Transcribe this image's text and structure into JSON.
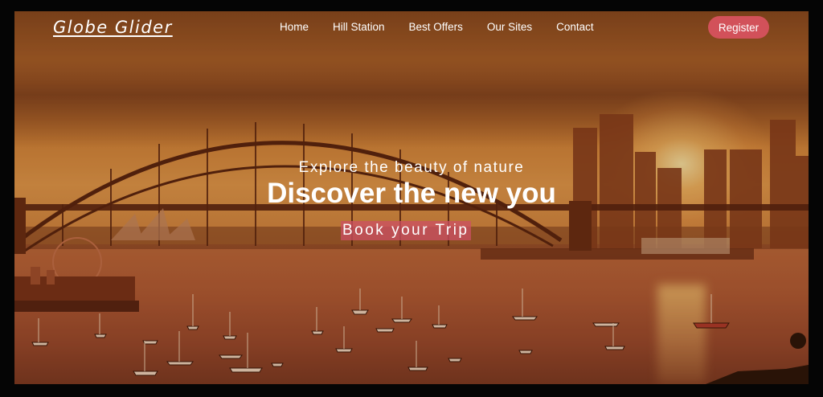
{
  "brand": {
    "name": "Globe Glider"
  },
  "nav": {
    "items": [
      {
        "label": "Home"
      },
      {
        "label": "Hill Station"
      },
      {
        "label": "Best Offers"
      },
      {
        "label": "Our Sites"
      },
      {
        "label": "Contact"
      }
    ],
    "register_label": "Register"
  },
  "hero": {
    "subtitle": "Explore the beauty of nature",
    "title": "Discover the new you",
    "cta_label": "Book your Trip"
  },
  "colors": {
    "accent": "#d2515a",
    "cta_bg": "#cd5064",
    "text": "#ffffff"
  }
}
